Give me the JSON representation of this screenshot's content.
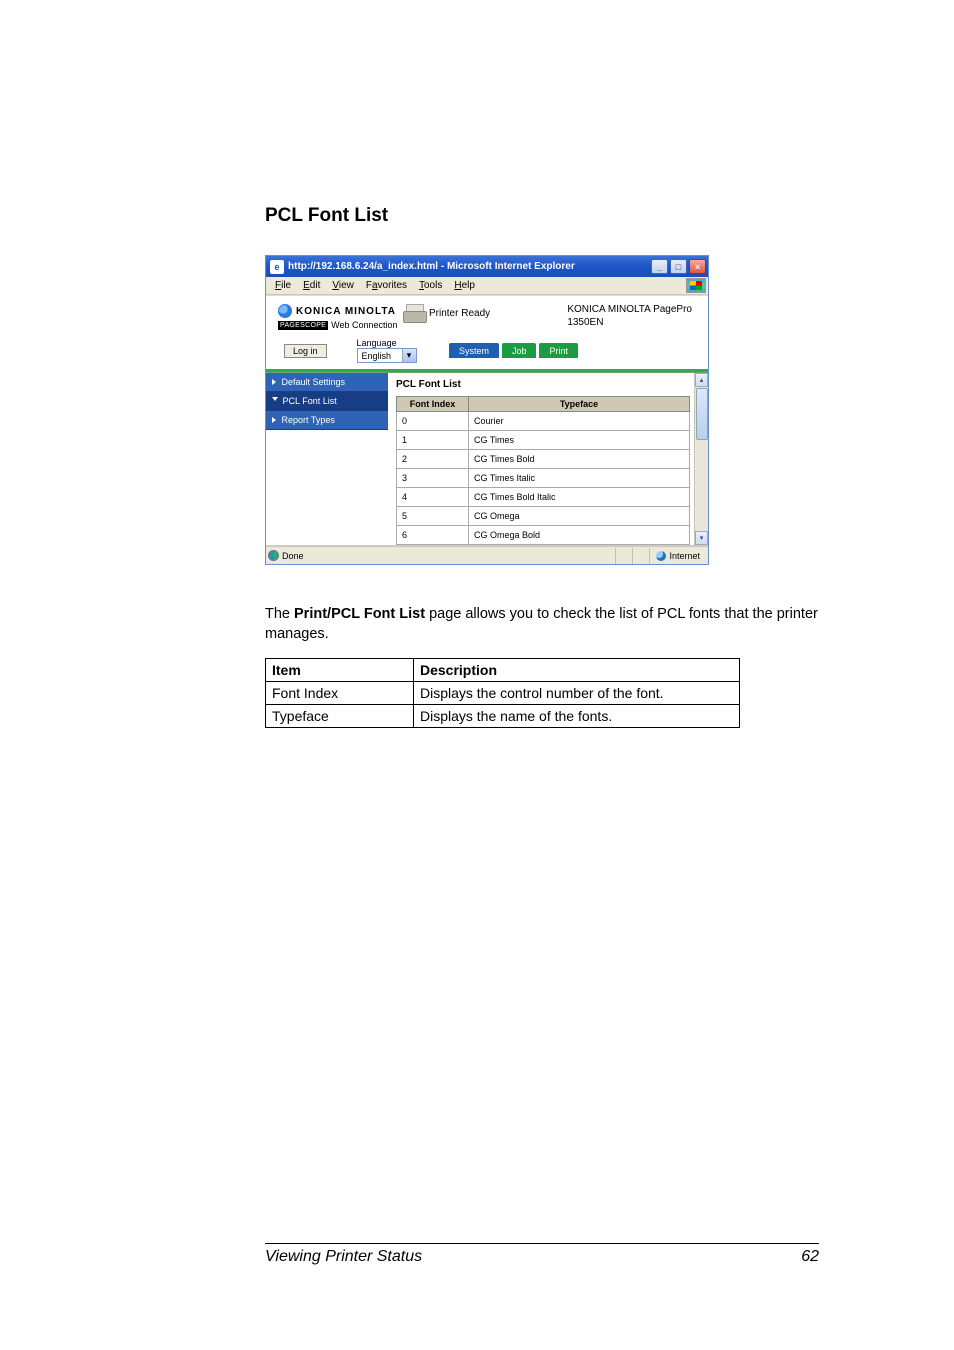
{
  "section_title": "PCL Font List",
  "browser": {
    "title": "http://192.168.6.24/a_index.html - Microsoft Internet Explorer",
    "menus": {
      "file": "File",
      "edit": "Edit",
      "view": "View",
      "favorites": "Favorites",
      "tools": "Tools",
      "help": "Help"
    }
  },
  "header": {
    "brand": "KONICA MINOLTA",
    "pagescope": "PAGESCOPE",
    "webconn": "Web Connection",
    "status": "Printer Ready",
    "model_l1": "KONICA MINOLTA PagePro",
    "model_l2": "1350EN"
  },
  "login": {
    "button": "Log in",
    "lang_label": "Language",
    "lang_value": "English"
  },
  "tabs": {
    "system": "System",
    "job": "Job",
    "print": "Print"
  },
  "nav": {
    "default_settings": "Default Settings",
    "pcl_font_list": "PCL Font List",
    "report_types": "Report Types"
  },
  "pane": {
    "title": "PCL Font List",
    "col1": "Font Index",
    "col2": "Typeface",
    "rows": [
      {
        "idx": "0",
        "face": "Courier"
      },
      {
        "idx": "1",
        "face": "CG Times"
      },
      {
        "idx": "2",
        "face": "CG Times Bold"
      },
      {
        "idx": "3",
        "face": "CG Times Italic"
      },
      {
        "idx": "4",
        "face": "CG Times Bold Italic"
      },
      {
        "idx": "5",
        "face": "CG Omega"
      },
      {
        "idx": "6",
        "face": "CG Omega Bold"
      }
    ]
  },
  "statusbar": {
    "done": "Done",
    "internet": "Internet"
  },
  "body": {
    "p1a": "The ",
    "p1b": "Print/PCL Font List",
    "p1c": " page allows you to check the list of PCL fonts that the printer manages."
  },
  "desc": {
    "h1": "Item",
    "h2": "Description",
    "r1c1": "Font Index",
    "r1c2": "Displays the control number of the font.",
    "r2c1": "Typeface",
    "r2c2": "Displays the name of the fonts."
  },
  "footer": {
    "left": "Viewing Printer Status",
    "right": "62"
  }
}
